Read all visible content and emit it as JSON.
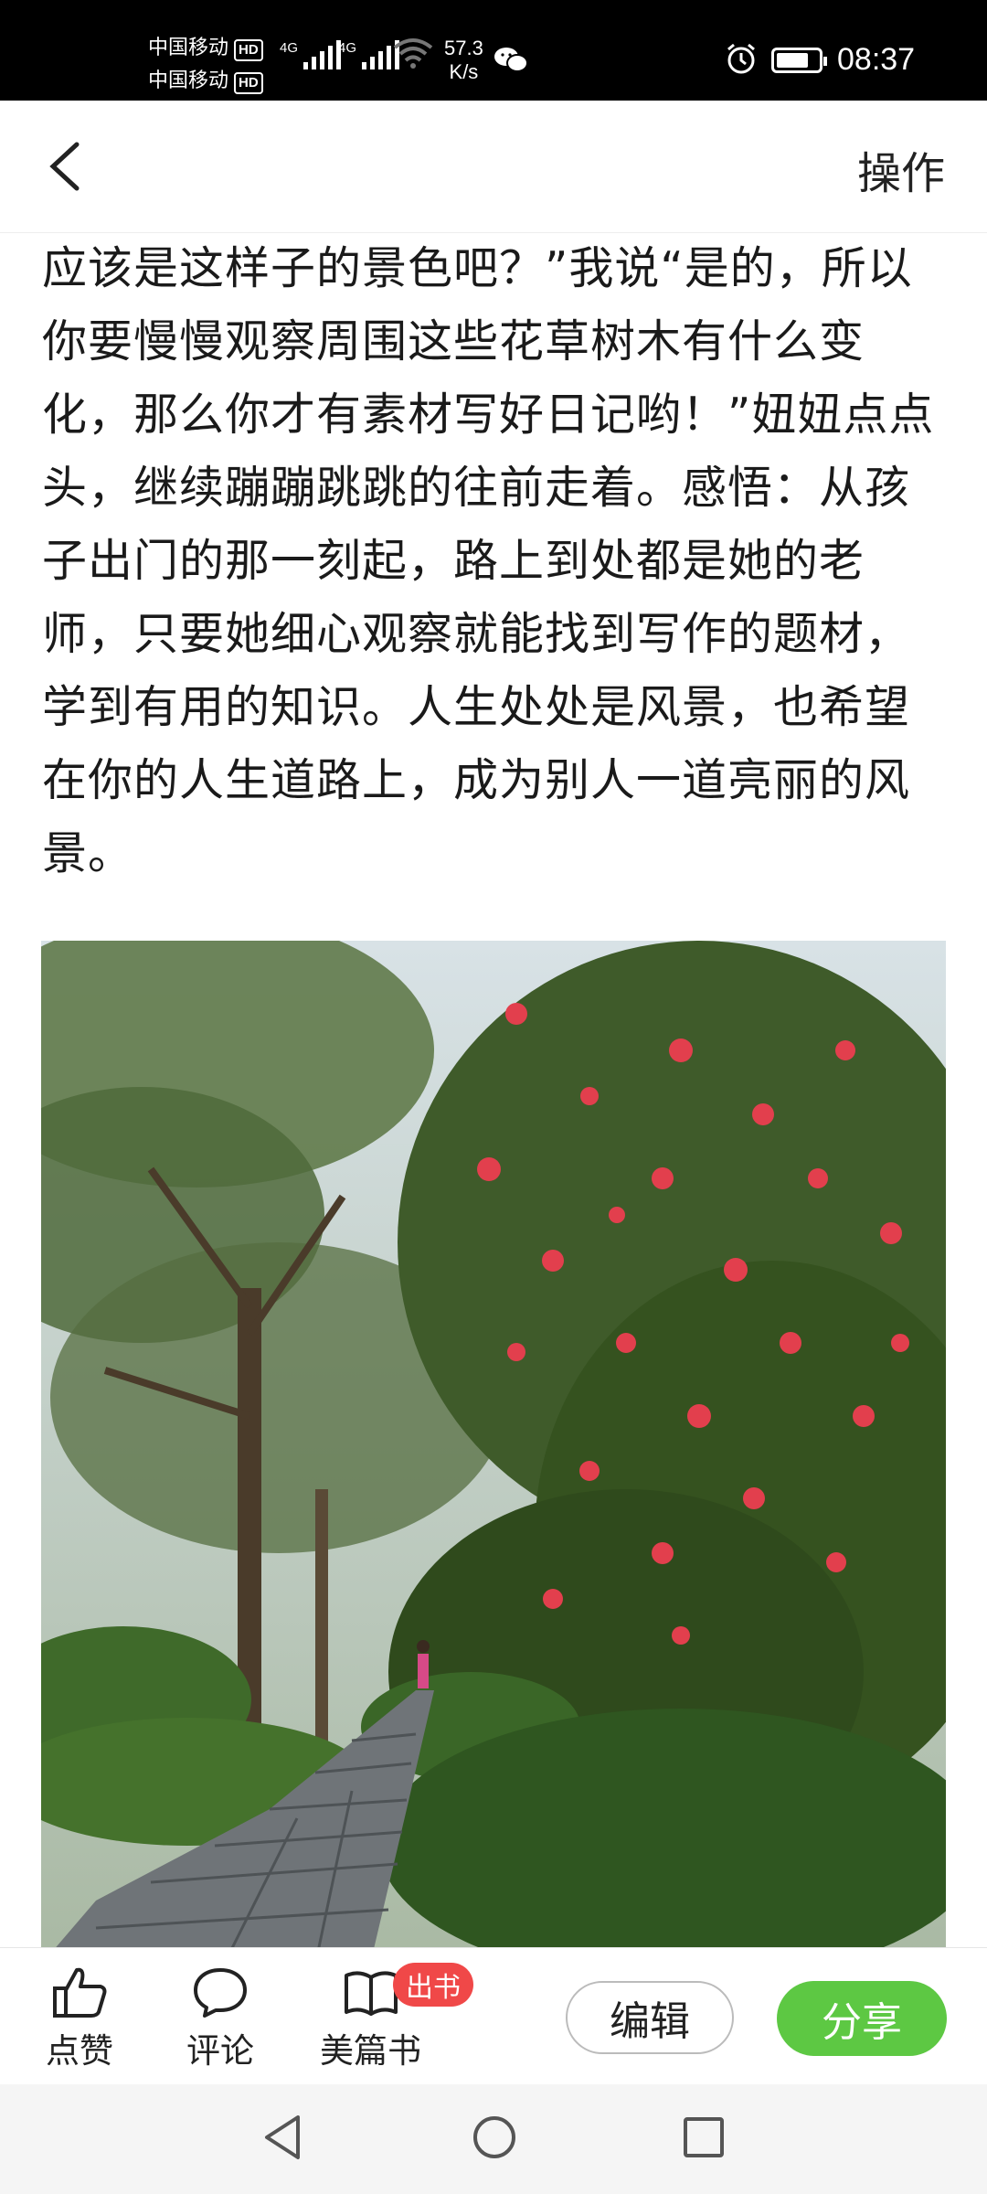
{
  "status": {
    "carrier1": "中国移动",
    "carrier2": "中国移动",
    "hd": "HD",
    "network1": "4G",
    "network2": "4G",
    "speed_value": "57.3",
    "speed_unit": "K/s",
    "time": "08:37",
    "icons": [
      "wifi-icon",
      "wechat-icon",
      "alarm-icon",
      "battery-icon"
    ]
  },
  "header": {
    "back_icon": "chevron-left-icon",
    "operate_label": "操作"
  },
  "article": {
    "text": "大子有的京京，老师还我们写的日记（日景）应该是这样子的景色吧？”我说“是的，所以你要慢慢观察周围这些花草树木有什么变化，那么你才有素材写好日记哟！”妞妞点点头，继续蹦蹦跳跳的往前走着。感悟：从孩子出门的那一刻起，路上到处都是她的老师，只要她细心观察就能找到写作的题材，学到有用的知识。人生处处是风景，也希望在你的人生道路上，成为别人一道亮丽的风景。"
  },
  "actions": {
    "like_label": "点赞",
    "comment_label": "评论",
    "book_label": "美篇书",
    "book_badge": "出书",
    "edit_label": "编辑",
    "share_label": "分享"
  },
  "colors": {
    "share_green": "#5dc843",
    "badge_red": "#f04848"
  }
}
